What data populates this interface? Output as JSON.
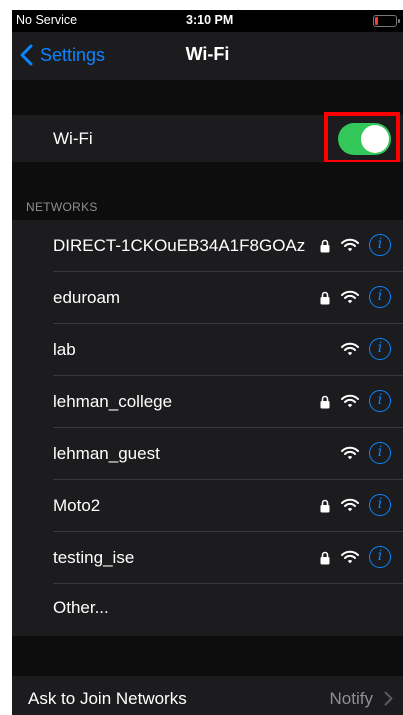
{
  "status_bar": {
    "carrier": "No Service",
    "time": "3:10 PM",
    "battery_color": "#ff3b30"
  },
  "nav": {
    "back_label": "Settings",
    "title": "Wi-Fi"
  },
  "wifi_toggle": {
    "label": "Wi-Fi",
    "on": true,
    "color": "#34c759"
  },
  "networks_header": "NETWORKS",
  "networks": [
    {
      "name": "DIRECT-1CKOuEB34A1F8GOAz",
      "secured": true,
      "signal_icon": "wifi-icon"
    },
    {
      "name": "eduroam",
      "secured": true,
      "signal_icon": "wifi-icon"
    },
    {
      "name": "lab",
      "secured": false,
      "signal_icon": "wifi-icon"
    },
    {
      "name": "lehman_college",
      "secured": true,
      "signal_icon": "wifi-icon"
    },
    {
      "name": "lehman_guest",
      "secured": false,
      "signal_icon": "wifi-icon"
    },
    {
      "name": "Moto2",
      "secured": true,
      "signal_icon": "wifi-icon"
    },
    {
      "name": "testing_ise",
      "secured": true,
      "signal_icon": "wifi-icon"
    }
  ],
  "other_label": "Other...",
  "ask_to_join": {
    "label": "Ask to Join Networks",
    "value": "Notify"
  },
  "colors": {
    "accent": "#0a84ff",
    "highlight_box": "#ff0000"
  }
}
